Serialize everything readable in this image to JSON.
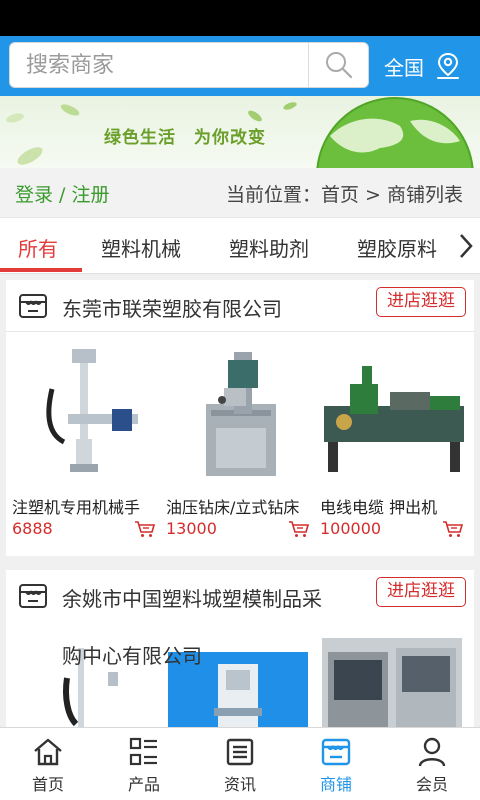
{
  "search": {
    "placeholder": "搜索商家",
    "region_label": "全国"
  },
  "banner": {
    "text": "绿色生活　为你改变"
  },
  "info": {
    "login_label": "登录 / 注册",
    "location": "当前位置：首页 > 商铺列表"
  },
  "categories": [
    {
      "label": "所有",
      "active": true
    },
    {
      "label": "塑料机械",
      "active": false
    },
    {
      "label": "塑料助剂",
      "active": false
    },
    {
      "label": "塑胶原料",
      "active": false
    }
  ],
  "shops": [
    {
      "name": "东莞市联荣塑胶有限公司",
      "visit_label": "进店逛逛",
      "products": [
        {
          "name": "注塑机专用机械手",
          "price": "6888"
        },
        {
          "name": "油压钻床/立式钻床",
          "price": "13000"
        },
        {
          "name": "电线电缆 押出机",
          "price": "100000"
        }
      ]
    },
    {
      "name_line1": "余姚市中国塑料城塑模制品采",
      "name_line2": "购中心有限公司",
      "visit_label": "进店逛逛"
    }
  ],
  "tabs": [
    {
      "label": "首页",
      "icon": "home-icon"
    },
    {
      "label": "产品",
      "icon": "grid-list-icon"
    },
    {
      "label": "资讯",
      "icon": "news-icon"
    },
    {
      "label": "商铺",
      "icon": "shop-icon",
      "active": true
    },
    {
      "label": "会员",
      "icon": "user-icon"
    }
  ],
  "colors": {
    "primary": "#2196e8",
    "accent_red": "#d42d2d",
    "green": "#3a9a2c"
  }
}
